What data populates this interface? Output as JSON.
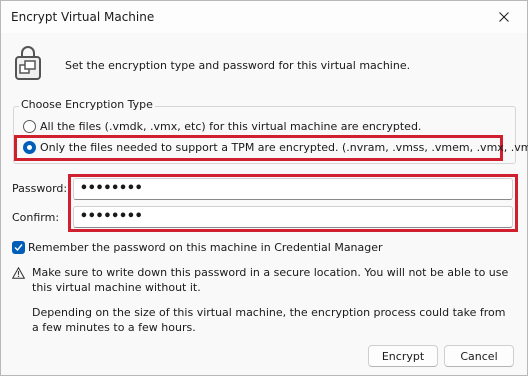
{
  "window": {
    "title": "Encrypt Virtual Machine"
  },
  "header": {
    "description": "Set the encryption type and password for this virtual machine."
  },
  "encryption_type": {
    "group_label": "Choose Encryption Type",
    "options": [
      {
        "label": "All the files (.vmdk, .vmx, etc) for this virtual machine are encrypted.",
        "selected": false
      },
      {
        "label": "Only the files needed to support a TPM are encrypted. (.nvram, .vmss, .vmem, .vmx, .vmsn)",
        "selected": true
      }
    ]
  },
  "fields": {
    "password": {
      "label": "Password:",
      "value": "••••••••"
    },
    "confirm": {
      "label": "Confirm:",
      "value": "••••••••"
    }
  },
  "remember": {
    "label": "Remember the password on this machine in Credential Manager",
    "checked": true
  },
  "warning": {
    "text": "Make sure to write down this password in a secure location. You will not be able to use this virtual machine without it."
  },
  "info": {
    "text": "Depending on the size of this virtual machine, the encryption process could take from a few minutes to a few hours."
  },
  "buttons": {
    "encrypt": "Encrypt",
    "cancel": "Cancel"
  },
  "colors": {
    "accent": "#005fb8",
    "highlight": "#d0202f"
  }
}
